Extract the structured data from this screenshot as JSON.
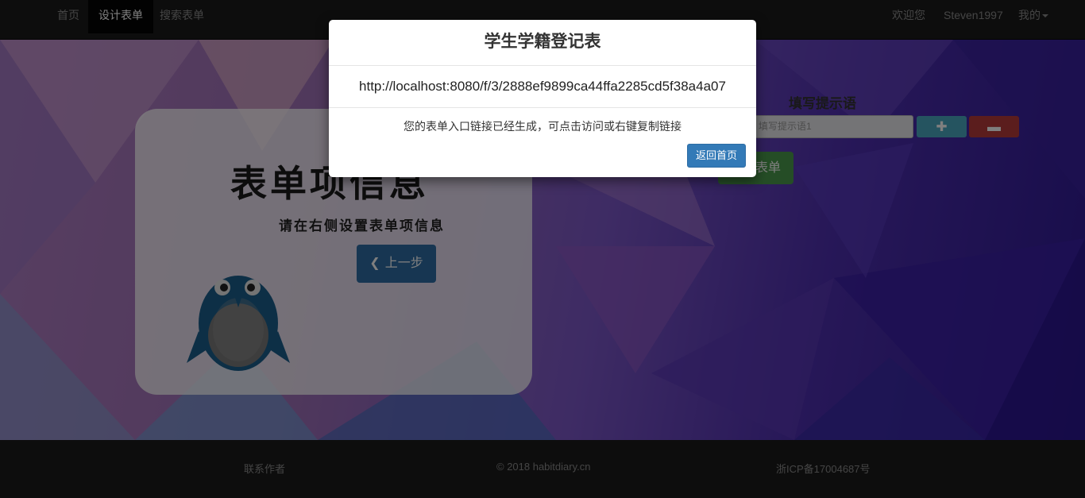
{
  "navbar": {
    "items": [
      {
        "label": "首页"
      },
      {
        "label": "设计表单"
      },
      {
        "label": "搜索表单"
      }
    ],
    "welcome": "欢迎您",
    "username": "Steven1997",
    "my_menu": "我的"
  },
  "card": {
    "title": "表单项信息",
    "subtitle": "请在右侧设置表单项信息",
    "prev_button": "上一步",
    "prev_icon": "chevron-left-icon"
  },
  "form": {
    "label": "填写提示语",
    "hint_placeholder": "填写提示语1",
    "add_icon": "plus-icon",
    "remove_icon": "minus-icon",
    "submit_label": "表单"
  },
  "footer": {
    "contact": "联系作者",
    "copyright": "© 2018 habitdiary.cn",
    "icp": "浙ICP备17004687号"
  },
  "modal": {
    "title": "学生学籍登记表",
    "link": "http://localhost:8080/f/3/2888ef9899ca44ffa2285cd5f38a4a07",
    "message": "您的表单入口链接已经生成，可点击访问或右键复制链接",
    "home_button": "返回首页"
  }
}
